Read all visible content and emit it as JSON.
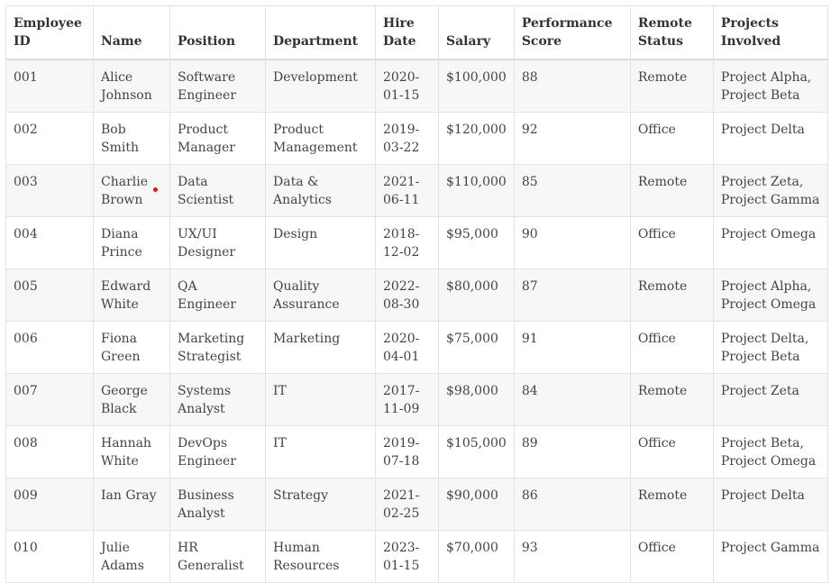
{
  "table": {
    "headers": [
      "Employee ID",
      "Name",
      "Position",
      "Department",
      "Hire Date",
      "Salary",
      "Performance Score",
      "Remote Status",
      "Projects Involved"
    ],
    "rows": [
      [
        "001",
        "Alice Johnson",
        "Software Engineer",
        "Development",
        "2020-01-15",
        "$100,000",
        "88",
        "Remote",
        "Project Alpha, Project Beta"
      ],
      [
        "002",
        "Bob Smith",
        "Product Manager",
        "Product Management",
        "2019-03-22",
        "$120,000",
        "92",
        "Office",
        "Project Delta"
      ],
      [
        "003",
        "Charlie Brown",
        "Data Scientist",
        "Data & Analytics",
        "2021-06-11",
        "$110,000",
        "85",
        "Remote",
        "Project Zeta, Project Gamma"
      ],
      [
        "004",
        "Diana Prince",
        "UX/UI Designer",
        "Design",
        "2018-12-02",
        "$95,000",
        "90",
        "Office",
        "Project Omega"
      ],
      [
        "005",
        "Edward White",
        "QA Engineer",
        "Quality Assurance",
        "2022-08-30",
        "$80,000",
        "87",
        "Remote",
        "Project Alpha, Project Omega"
      ],
      [
        "006",
        "Fiona Green",
        "Marketing Strategist",
        "Marketing",
        "2020-04-01",
        "$75,000",
        "91",
        "Office",
        "Project Delta, Project Beta"
      ],
      [
        "007",
        "George Black",
        "Systems Analyst",
        "IT",
        "2017-11-09",
        "$98,000",
        "84",
        "Remote",
        "Project Zeta"
      ],
      [
        "008",
        "Hannah White",
        "DevOps Engineer",
        "IT",
        "2019-07-18",
        "$105,000",
        "89",
        "Office",
        "Project Beta, Project Omega"
      ],
      [
        "009",
        "Ian Gray",
        "Business Analyst",
        "Strategy",
        "2021-02-25",
        "$90,000",
        "86",
        "Remote",
        "Project Delta"
      ],
      [
        "010",
        "Julie Adams",
        "HR Generalist",
        "Human Resources",
        "2023-01-15",
        "$70,000",
        "93",
        "Office",
        "Project Gamma"
      ]
    ]
  },
  "colors": {
    "marker_dot": "#e0141e",
    "stripe": "#f7f7f7",
    "border": "#e3e3e3"
  }
}
